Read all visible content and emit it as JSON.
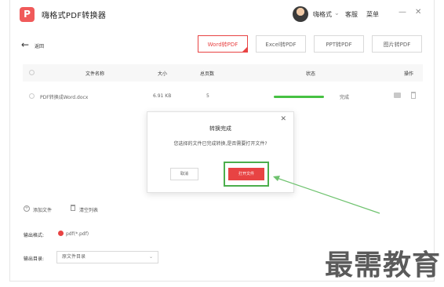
{
  "app": {
    "logo_glyph": "P",
    "title": "嗨格式PDF转换器"
  },
  "titlebar": {
    "user_name": "嗨格式",
    "user_caret": "⌄",
    "service_label": "客服",
    "menu_label": "菜单",
    "minimize_glyph": "—",
    "close_glyph": "✕"
  },
  "nav": {
    "back_glyph": "←",
    "back_label": "返回"
  },
  "tabs": [
    {
      "label": "Word转PDF",
      "active": true
    },
    {
      "label": "Excel转PDF",
      "active": false
    },
    {
      "label": "PPT转PDF",
      "active": false
    },
    {
      "label": "图片转PDF",
      "active": false
    }
  ],
  "table": {
    "headers": {
      "name": "文件名称",
      "size": "大小",
      "pages": "总页数",
      "status": "状态",
      "actions": "操作"
    },
    "rows": [
      {
        "name": "PDF转换成Word.docx",
        "size": "6.91 KB",
        "pages": "5",
        "progress": 1.0,
        "status": "完成"
      }
    ]
  },
  "bottom": {
    "add_file_glyph": "+",
    "add_file": "添加文件",
    "clear_list": "清空列表",
    "output_format_label": "输出格式:",
    "output_format_value": "pdf(*.pdf)",
    "output_dir_label": "输出目录:",
    "output_dir_value": "原文件目录",
    "output_dir_caret": "⌄"
  },
  "dialog": {
    "title": "转换完成",
    "close_glyph": "✕",
    "message": "您选择的文件已完成转换,是否需要打开文件?",
    "cancel_label": "取消",
    "open_label": "打开文件"
  },
  "watermark": {
    "text": "最需教育"
  },
  "colors": {
    "accent": "#e84343",
    "progress": "#46c142",
    "highlight": "#4cae4c"
  },
  "icons": {
    "folder": "folder-icon",
    "trash": "trash-icon",
    "clear": "trash-icon"
  }
}
